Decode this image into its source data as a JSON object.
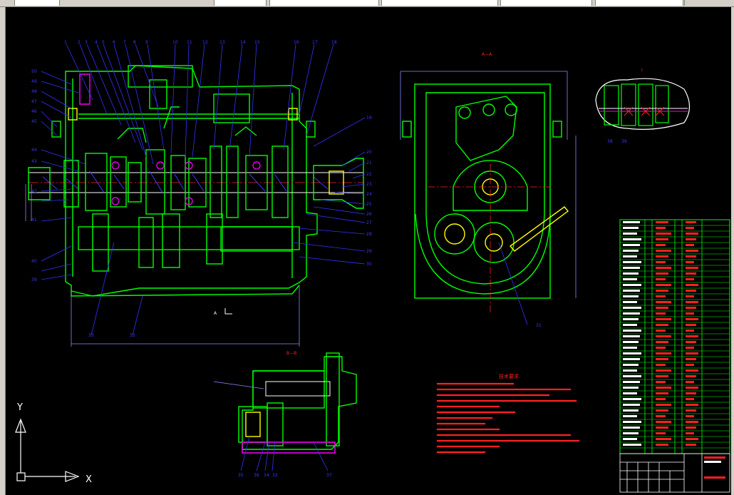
{
  "toolbar": {
    "fields": [
      "",
      "",
      "",
      "",
      "",
      ""
    ]
  },
  "drawing": {
    "view_labels": {
      "section_aa": "A—A",
      "section_bb": "B—B",
      "detail": "I",
      "mark_a": "A"
    },
    "tech_req_title": "技术要求",
    "ucs": {
      "x_label": "X",
      "y_label": "Y"
    },
    "balloons_top": [
      "1",
      "2",
      "3",
      "4",
      "5",
      "6",
      "7",
      "8",
      "9",
      "10",
      "11",
      "12",
      "13",
      "14",
      "15",
      "16",
      "17",
      "18"
    ],
    "balloons_left": [
      "50",
      "49",
      "48",
      "47",
      "46",
      "45",
      "44",
      "43",
      "42",
      "41",
      "40",
      "39"
    ],
    "balloons_right": [
      "19",
      "20",
      "21",
      "22",
      "23",
      "24",
      "25",
      "26",
      "27",
      "28",
      "29",
      "30",
      "31"
    ],
    "balloons_bottom": [
      "33",
      "32"
    ],
    "bb_balloons": [
      "35",
      "36",
      "34",
      "32",
      "37"
    ],
    "detail_balloons": [
      "38",
      "39"
    ],
    "aa_balloon": "31"
  },
  "colors": {
    "background": "#000000",
    "outline": "#00ff00",
    "leader": "#0000ff",
    "dim": "#8a8aff",
    "text_red": "#ff2020",
    "white": "#ffffff",
    "yellow": "#ffff00",
    "magenta": "#ff00ff"
  }
}
